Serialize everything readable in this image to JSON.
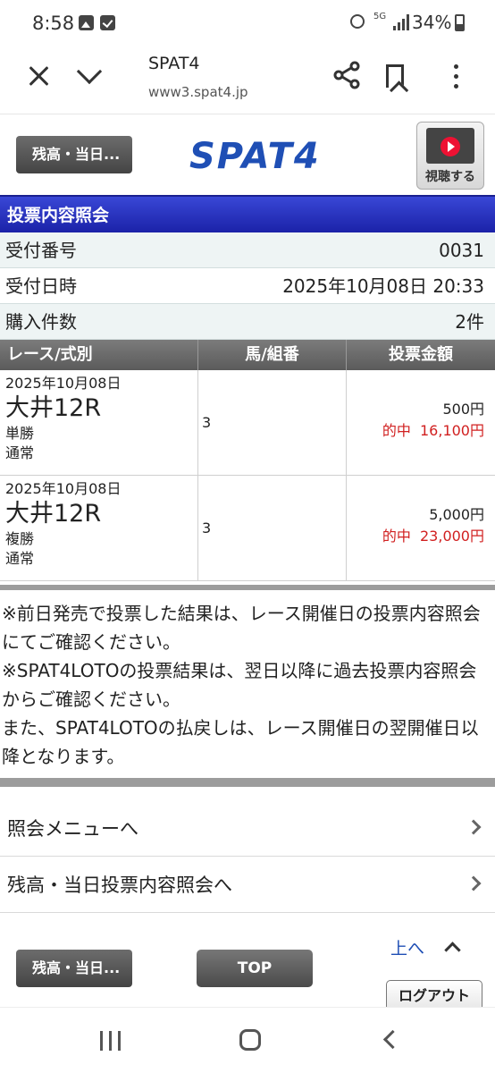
{
  "status_bar": {
    "time": "8:58",
    "battery": "34%",
    "network": "5G"
  },
  "browser": {
    "title": "SPAT4",
    "url": "www3.spat4.jp"
  },
  "header": {
    "back_button": "残高・当日...",
    "logo": "SPAT4",
    "watch_label": "視聴する"
  },
  "section_title": "投票内容照会",
  "info": [
    {
      "label": "受付番号",
      "value": "0031"
    },
    {
      "label": "受付日時",
      "value": "2025年10月08日 20:33"
    },
    {
      "label": "購入件数",
      "value": "2件"
    }
  ],
  "table": {
    "headers": [
      "レース/式別",
      "馬/組番",
      "投票金額"
    ],
    "rows": [
      {
        "date": "2025年10月08日",
        "race": "大井12R",
        "bet_type": "単勝",
        "mode": "通常",
        "number": "3",
        "amount": "500円",
        "hit_label": "的中",
        "payout": "16,100円"
      },
      {
        "date": "2025年10月08日",
        "race": "大井12R",
        "bet_type": "複勝",
        "mode": "通常",
        "number": "3",
        "amount": "5,000円",
        "hit_label": "的中",
        "payout": "23,000円"
      }
    ]
  },
  "notes": [
    "※前日発売で投票した結果は、レース開催日の投票内容照会にてご確認ください。",
    "※SPAT4LOTOの投票結果は、翌日以降に過去投票内容照会からご確認ください。",
    "また、SPAT4LOTOの払戻しは、レース開催日の翌開催日以降となります。"
  ],
  "menu": [
    {
      "label": "照会メニューへ"
    },
    {
      "label": "残高・当日投票内容照会へ"
    }
  ],
  "footer": {
    "back_button": "残高・当日...",
    "top_button": "TOP",
    "up_link": "上へ",
    "logout": "ログアウト"
  },
  "colors": {
    "section_blue": "#2b36c4",
    "logo_blue": "#1f4fb5",
    "hit_red": "#d12020"
  }
}
